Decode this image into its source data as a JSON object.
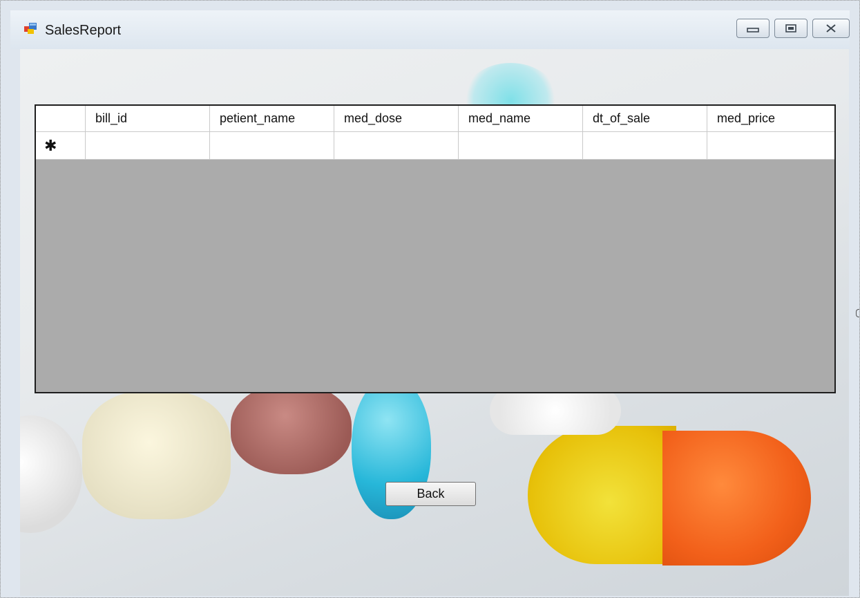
{
  "window": {
    "title": "SalesReport",
    "controls": [
      "minimize-icon",
      "maximize-icon",
      "close-icon"
    ]
  },
  "grid": {
    "columns": [
      "bill_id",
      "petient_name",
      "med_dose",
      "med_name",
      "dt_of_sale",
      "med_price"
    ],
    "new_row_marker": "✱",
    "new_row_values": [
      "",
      "",
      "",
      "",
      "",
      ""
    ]
  },
  "buttons": {
    "back_label": "Back"
  },
  "colors": {
    "grid_empty_area": "#ababab",
    "grid_border": "#1e1e1e"
  }
}
